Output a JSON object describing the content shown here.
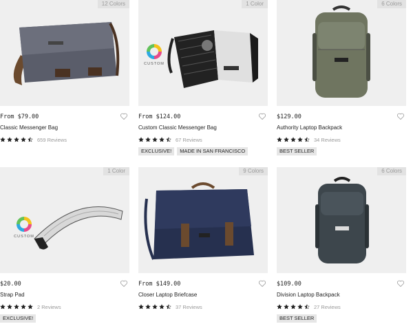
{
  "products": [
    {
      "colors_badge": "12 Colors",
      "price": "From $79.00",
      "name": "Classic Messenger Bag",
      "rating": 4.5,
      "reviews": "659 Reviews",
      "tags": [],
      "custom": false
    },
    {
      "colors_badge": "1 Color",
      "price": "From $124.00",
      "name": "Custom Classic Messenger Bag",
      "rating": 4.5,
      "reviews": "67 Reviews",
      "tags": [
        "EXCLUSIVE!",
        "MADE IN SAN FRANCISCO"
      ],
      "custom": true,
      "custom_label": "CUSTOM"
    },
    {
      "colors_badge": "6 Colors",
      "price": "$129.00",
      "name": "Authority Laptop Backpack",
      "rating": 4.5,
      "reviews": "34 Reviews",
      "tags": [
        "BEST SELLER"
      ],
      "custom": false
    },
    {
      "colors_badge": "1 Color",
      "price": "$20.00",
      "name": "Strap Pad",
      "rating": 5,
      "reviews": "2 Reviews",
      "tags": [
        "EXCLUSIVE!"
      ],
      "custom": true,
      "custom_label": "CUSTOM"
    },
    {
      "colors_badge": "9 Colors",
      "price": "From $149.00",
      "name": "Closer Laptop Briefcase",
      "rating": 4.5,
      "reviews": "37 Reviews",
      "tags": [],
      "custom": false
    },
    {
      "colors_badge": "6 Colors",
      "price": "$109.00",
      "name": "Division Laptop Backpack",
      "rating": 4.5,
      "reviews": "27 Reviews",
      "tags": [
        "BEST SELLER"
      ],
      "custom": false
    }
  ],
  "icons": {
    "wishlist": "heart-outline-icon",
    "rating": "star-icon"
  },
  "colors": {
    "tile_bg": "#efefef",
    "star": "#222222",
    "badge_text": "#9a9a9a",
    "tag_bg": "#e6e6e6"
  }
}
